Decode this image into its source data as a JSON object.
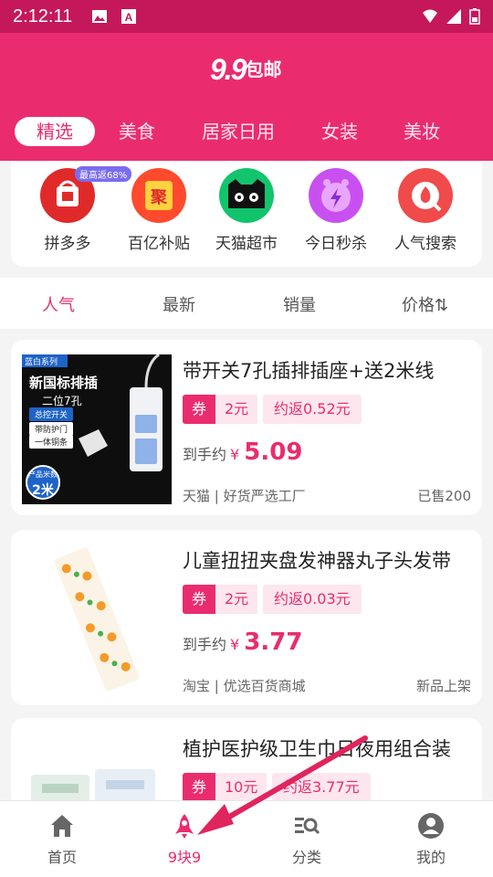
{
  "status": {
    "time": "2:12:11"
  },
  "header": {
    "logo_num": "9.9",
    "logo_text": "包邮"
  },
  "tabs": [
    {
      "label": "精选",
      "active": true
    },
    {
      "label": "美食"
    },
    {
      "label": "居家日用"
    },
    {
      "label": "女装"
    },
    {
      "label": "美妆"
    }
  ],
  "quick": [
    {
      "label": "拼多多",
      "badge": "最高返68%",
      "icon": "pinduoduo-icon"
    },
    {
      "label": "百亿补贴",
      "icon": "subsidy-icon",
      "glyph": "聚"
    },
    {
      "label": "天猫超市",
      "icon": "tmall-icon"
    },
    {
      "label": "今日秒杀",
      "icon": "flash-sale-icon"
    },
    {
      "label": "人气搜索",
      "icon": "hot-search-icon"
    }
  ],
  "sort": [
    {
      "label": "人气",
      "active": true
    },
    {
      "label": "最新"
    },
    {
      "label": "销量"
    },
    {
      "label": "价格⇅"
    }
  ],
  "products": [
    {
      "title": "带开关7孔插排插座+送2米线",
      "coupon_label": "券",
      "coupon": "2元",
      "rebate": "约返0.52元",
      "price_label": "到手约",
      "yen": "¥",
      "price": "5.09",
      "shop": "天猫 | 好货严选工厂",
      "sold": "已售200",
      "thumb_tag": "蓝白系列",
      "thumb_title": "新国标排插",
      "thumb_sub": "二位7孔",
      "thumb_lines": [
        "总控开关",
        "带防护门",
        "一体铜条"
      ],
      "thumb_badge_top": "产品米数",
      "thumb_badge_num": "2米"
    },
    {
      "title": "儿童扭扭夹盘发神器丸子头发带",
      "coupon_label": "券",
      "coupon": "2元",
      "rebate": "约返0.03元",
      "price_label": "到手约",
      "yen": "¥",
      "price": "3.77",
      "shop": "淘宝 | 优选百货商城",
      "sold": "新品上架"
    },
    {
      "title": "植护医护级卫生巾日夜用组合装",
      "coupon_label": "券",
      "coupon": "10元",
      "rebate": "约返3.77元"
    }
  ],
  "nav": [
    {
      "label": "首页",
      "icon": "home-icon"
    },
    {
      "label": "9块9",
      "icon": "rocket-icon",
      "active": true
    },
    {
      "label": "分类",
      "icon": "category-search-icon"
    },
    {
      "label": "我的",
      "icon": "profile-icon"
    }
  ],
  "colors": {
    "brand": "#ea2c6e",
    "status_bar": "#c4185a",
    "arrow": "#e0245e"
  }
}
